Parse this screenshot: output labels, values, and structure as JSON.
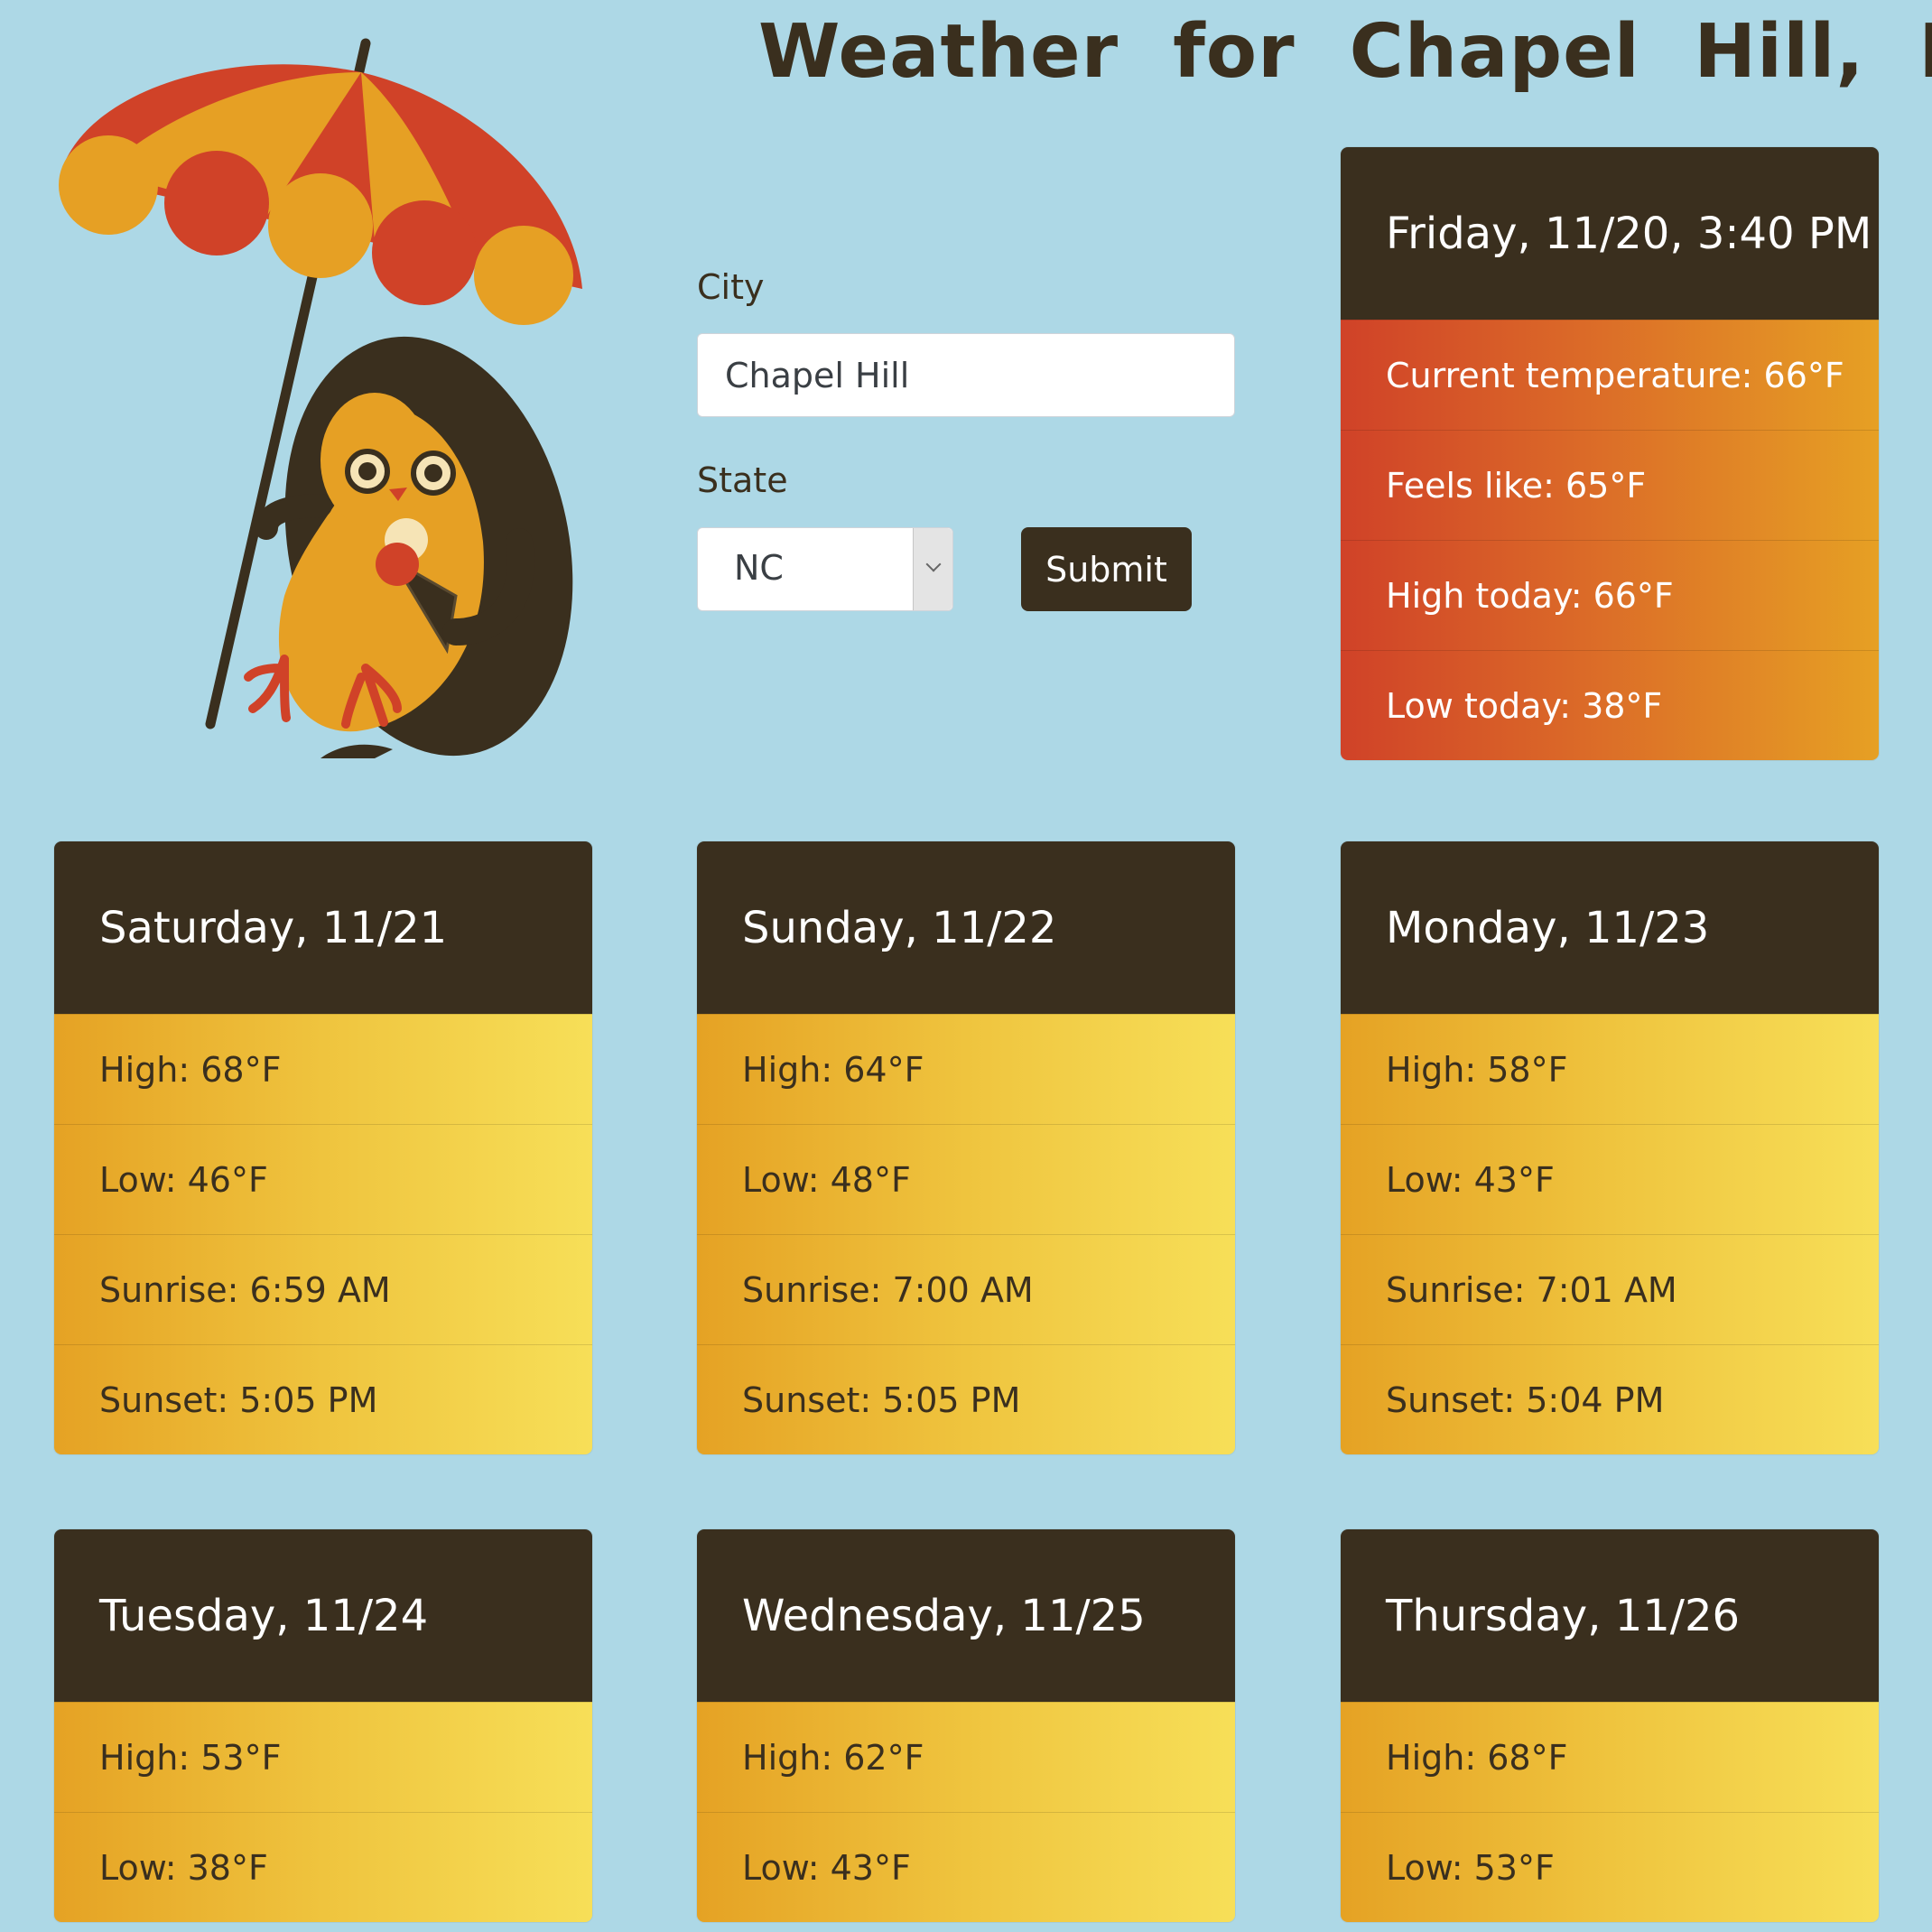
{
  "header": {
    "title_word1": "Weather",
    "title_word2": "for",
    "title_location": "Chapel Hill, NC"
  },
  "form": {
    "city_label": "City",
    "city_value": "Chapel Hill",
    "state_label": "State",
    "state_value": "NC",
    "submit_label": "Submit"
  },
  "today": {
    "date_time": "Friday, 11/20, 3:40 PM",
    "current": "Current temperature: 66°F",
    "feels_like": "Feels like: 65°F",
    "high": "High today: 66°F",
    "low": "Low today: 38°F"
  },
  "forecast": [
    {
      "day": "Saturday, 11/21",
      "high": "High: 68°F",
      "low": "Low: 46°F",
      "sunrise": "Sunrise: 6:59 AM",
      "sunset": "Sunset: 5:05 PM"
    },
    {
      "day": "Sunday, 11/22",
      "high": "High: 64°F",
      "low": "Low: 48°F",
      "sunrise": "Sunrise: 7:00 AM",
      "sunset": "Sunset: 5:05 PM"
    },
    {
      "day": "Monday, 11/23",
      "high": "High: 58°F",
      "low": "Low: 43°F",
      "sunrise": "Sunrise: 7:01 AM",
      "sunset": "Sunset: 5:04 PM"
    },
    {
      "day": "Tuesday, 11/24",
      "high": "High: 53°F",
      "low": "Low: 38°F"
    },
    {
      "day": "Wednesday, 11/25",
      "high": "High: 62°F",
      "low": "Low: 43°F"
    },
    {
      "day": "Thursday, 11/26",
      "high": "High: 68°F",
      "low": "Low: 53°F"
    }
  ],
  "colors": {
    "background": "#add8e6",
    "dark_brown": "#3a2f1e",
    "today_gradient_start": "#d04228",
    "today_gradient_end": "#e6a024",
    "forecast_gradient_start": "#e5a224",
    "forecast_gradient_end": "#f7df58"
  },
  "icons": {
    "mascot": "penguin-with-umbrella-illustration",
    "select_arrow": "chevron-down-icon"
  }
}
